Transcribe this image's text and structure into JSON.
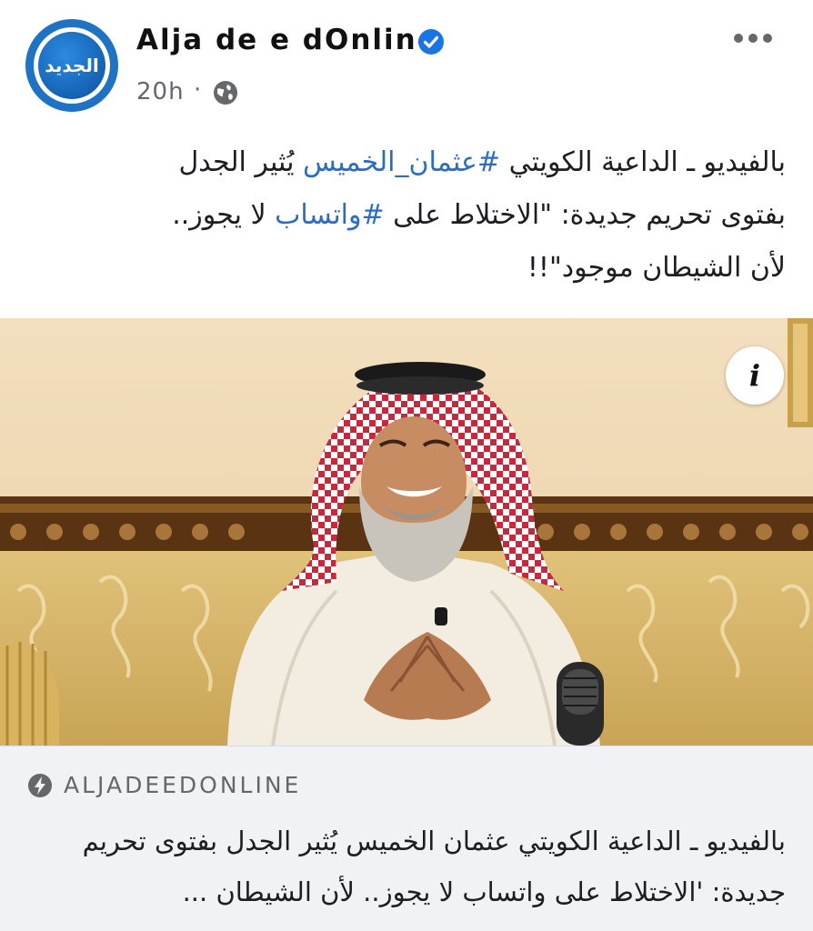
{
  "post": {
    "page_name": "Alja de e dOnline",
    "avatar_text": "الجديد",
    "verified": true,
    "time": "20h",
    "separator": "·",
    "audience_icon": "globe-icon",
    "more_icon": "more-options-icon",
    "text": {
      "line1_pre": "بالفيديو ـ الداعية الكويتي ",
      "hashtag1": "#عثمان_الخميس",
      "line1_post": " يُثير الجدل",
      "line2_pre": "بفتوى تحريم جديدة: \"الاختلاط على ",
      "hashtag2": "#واتساب",
      "line2_post": " لا يجوز..",
      "line3": "لأن الشيطان موجود\"!!"
    }
  },
  "media": {
    "info_label": "i"
  },
  "link_preview": {
    "domain_icon": "bolt-icon",
    "domain": "ALJADEEDONLINE",
    "title": "بالفيديو ـ الداعية الكويتي عثمان الخميس يُثير الجدل بفتوى تحريم جديدة: 'الاختلاط على واتساب لا يجوز.. لأن الشيطان ..."
  },
  "colors": {
    "verified": "#1b74e4",
    "hashtag": "#2b6cc4",
    "meta": "#65676b",
    "preview_bg": "#f0f2f5",
    "avatar_ring": "#1e73c5"
  }
}
